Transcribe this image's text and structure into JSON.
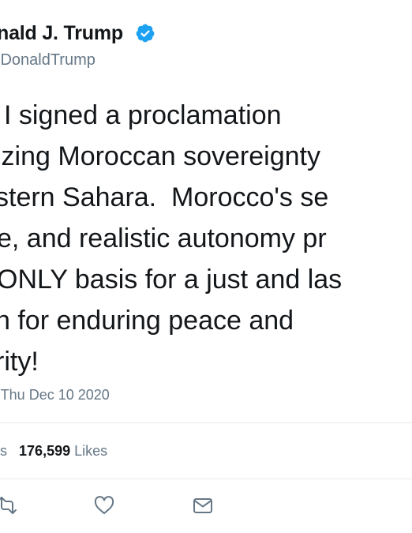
{
  "tweet": {
    "display_name": "nald J. Trump",
    "handle": "lDonaldTrump",
    "verified": true,
    "text_lines": [
      "I signed a proclamation",
      "izing Moroccan sovereignty",
      "stern Sahara.  Morocco's se",
      "e, and realistic autonomy pr",
      "ONLY basis for a just and las",
      "n for enduring peace and",
      "rity!"
    ],
    "timestamp": "Thu Dec 10 2020",
    "stats": {
      "retweets_label_fragment": "ets",
      "likes_count": "176,599",
      "likes_label": "Likes"
    }
  },
  "actions": {
    "retweet_icon": "retweet-icon",
    "like_icon": "heart-icon",
    "message_icon": "message-icon"
  },
  "colors": {
    "text_primary": "#14171a",
    "text_secondary": "#657786",
    "verified_blue": "#1da1f2",
    "divider": "#e6ecf0"
  }
}
